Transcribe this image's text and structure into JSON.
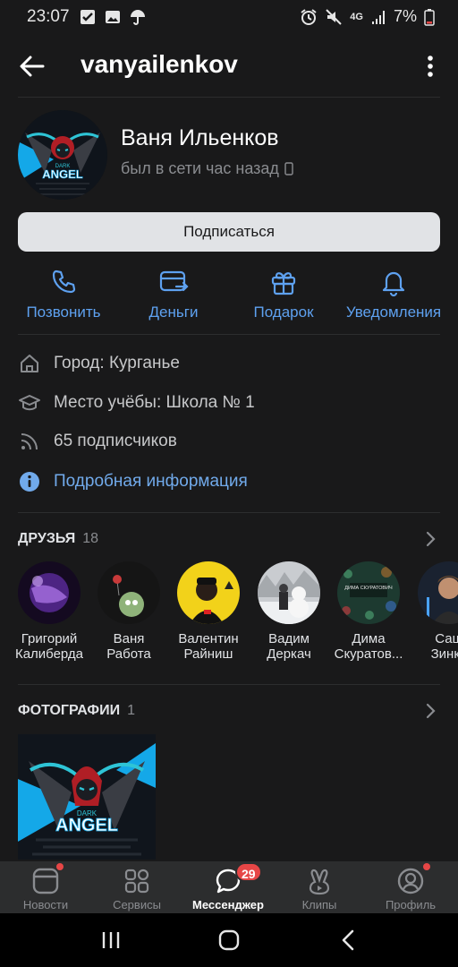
{
  "status_bar": {
    "time": "23:07",
    "battery": "7%",
    "network": "4G"
  },
  "app_bar": {
    "title": "vanyailenkov"
  },
  "profile": {
    "name": "Ваня Ильенков",
    "status": "был в сети час назад",
    "subscribe_label": "Подписаться"
  },
  "actions": [
    {
      "label": "Позвонить",
      "icon": "phone-icon"
    },
    {
      "label": "Деньги",
      "icon": "money-transfer-icon"
    },
    {
      "label": "Подарок",
      "icon": "gift-icon"
    },
    {
      "label": "Уведомления",
      "icon": "bell-icon"
    }
  ],
  "info": {
    "city": "Город: Курганье",
    "school": "Место учёбы: Школа № 1",
    "followers": "65 подписчиков",
    "details_link": "Подробная информация"
  },
  "friends": {
    "title": "ДРУЗЬЯ",
    "count": "18",
    "items": [
      {
        "line1": "Григорий",
        "line2": "Калиберда"
      },
      {
        "line1": "Ваня",
        "line2": "Работа"
      },
      {
        "line1": "Валентин",
        "line2": "Райниш"
      },
      {
        "line1": "Вадим",
        "line2": "Деркач"
      },
      {
        "line1": "Дима",
        "line2": "Скуратов..."
      },
      {
        "line1": "Саш",
        "line2": "Зинке"
      }
    ]
  },
  "photos": {
    "title": "ФОТОГРАФИИ",
    "count": "1"
  },
  "avatar_text": {
    "small": "DARK",
    "big": "ANGEL",
    "friend5_caption": "ДИМА СКУРАТОВИЧ"
  },
  "tabs": [
    {
      "label": "Новости",
      "icon": "news-icon"
    },
    {
      "label": "Сервисы",
      "icon": "services-icon"
    },
    {
      "label": "Мессенджер",
      "icon": "messenger-icon",
      "badge": "29"
    },
    {
      "label": "Клипы",
      "icon": "clips-icon"
    },
    {
      "label": "Профиль",
      "icon": "profile-icon"
    }
  ],
  "colors": {
    "background": "#19191a",
    "accent": "#71aaeb",
    "badge": "#e64646"
  }
}
